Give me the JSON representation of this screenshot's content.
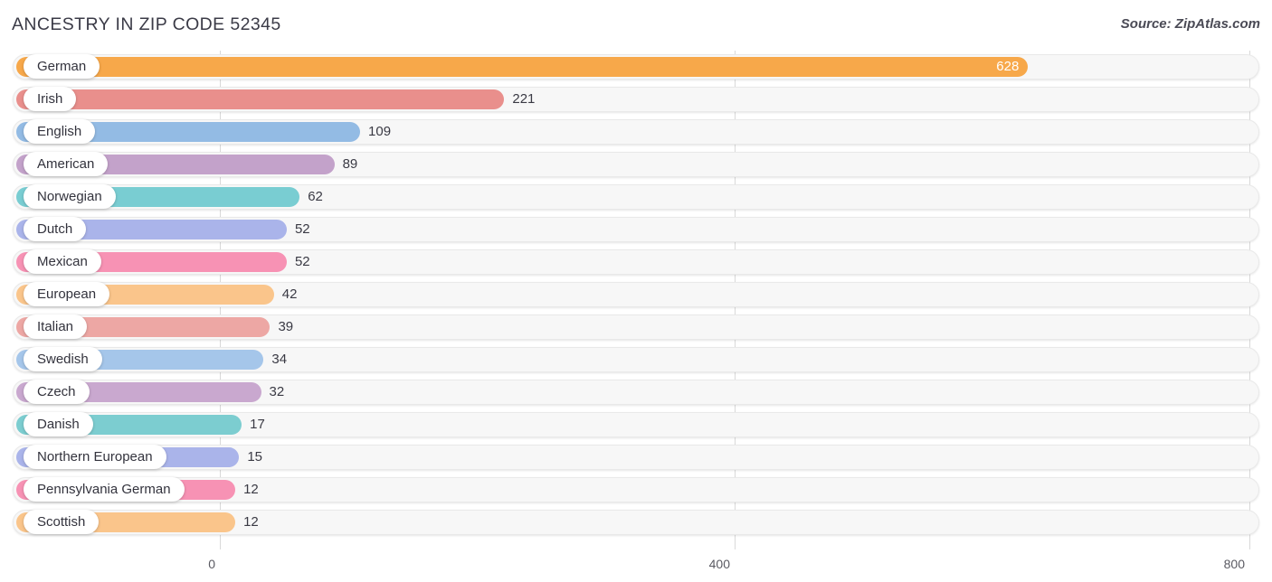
{
  "header": {
    "title": "ANCESTRY IN ZIP CODE 52345",
    "source": "Source: ZipAtlas.com"
  },
  "axis": {
    "ticks": [
      "0",
      "400",
      "800"
    ],
    "tick_values": [
      0,
      400,
      800
    ]
  },
  "chart_data": {
    "type": "bar",
    "orientation": "horizontal",
    "title": "ANCESTRY IN ZIP CODE 52345",
    "xlabel": "",
    "ylabel": "",
    "xlim": [
      0,
      800
    ],
    "grid": true,
    "legend": "none",
    "categories": [
      "German",
      "Irish",
      "English",
      "American",
      "Norwegian",
      "Dutch",
      "Mexican",
      "European",
      "Italian",
      "Swedish",
      "Czech",
      "Danish",
      "Northern European",
      "Pennsylvania German",
      "Scottish"
    ],
    "values": [
      628,
      221,
      109,
      89,
      62,
      52,
      52,
      42,
      39,
      34,
      32,
      17,
      15,
      12,
      12
    ],
    "colors": [
      "#f7a84a",
      "#e98f8c",
      "#93bbe4",
      "#c3a2ca",
      "#79cdd2",
      "#aab4ea",
      "#f792b4",
      "#fac58b",
      "#eda7a4",
      "#a5c6ea",
      "#c9a8cf",
      "#7ccdd0",
      "#aab4ea",
      "#f792b4",
      "#fac58b"
    ],
    "bars": [
      {
        "label": "German",
        "value": 628,
        "value_label": "628",
        "color": "#f7a84a",
        "label_inside_bar": true
      },
      {
        "label": "Irish",
        "value": 221,
        "value_label": "221",
        "color": "#e98f8c",
        "label_inside_bar": false
      },
      {
        "label": "English",
        "value": 109,
        "value_label": "109",
        "color": "#93bbe4",
        "label_inside_bar": false
      },
      {
        "label": "American",
        "value": 89,
        "value_label": "89",
        "color": "#c3a2ca",
        "label_inside_bar": false
      },
      {
        "label": "Norwegian",
        "value": 62,
        "value_label": "62",
        "color": "#79cdd2",
        "label_inside_bar": false
      },
      {
        "label": "Dutch",
        "value": 52,
        "value_label": "52",
        "color": "#aab4ea",
        "label_inside_bar": false
      },
      {
        "label": "Mexican",
        "value": 52,
        "value_label": "52",
        "color": "#f792b4",
        "label_inside_bar": false
      },
      {
        "label": "European",
        "value": 42,
        "value_label": "42",
        "color": "#fac58b",
        "label_inside_bar": false
      },
      {
        "label": "Italian",
        "value": 39,
        "value_label": "39",
        "color": "#eda7a4",
        "label_inside_bar": false
      },
      {
        "label": "Swedish",
        "value": 34,
        "value_label": "34",
        "color": "#a5c6ea",
        "label_inside_bar": false
      },
      {
        "label": "Czech",
        "value": 32,
        "value_label": "32",
        "color": "#c9a8cf",
        "label_inside_bar": false
      },
      {
        "label": "Danish",
        "value": 17,
        "value_label": "17",
        "color": "#7ccdd0",
        "label_inside_bar": false
      },
      {
        "label": "Northern European",
        "value": 15,
        "value_label": "15",
        "color": "#aab4ea",
        "label_inside_bar": false
      },
      {
        "label": "Pennsylvania German",
        "value": 12,
        "value_label": "12",
        "color": "#f792b4",
        "label_inside_bar": false
      },
      {
        "label": "Scottish",
        "value": 12,
        "value_label": "12",
        "color": "#fac58b",
        "label_inside_bar": false
      }
    ]
  }
}
